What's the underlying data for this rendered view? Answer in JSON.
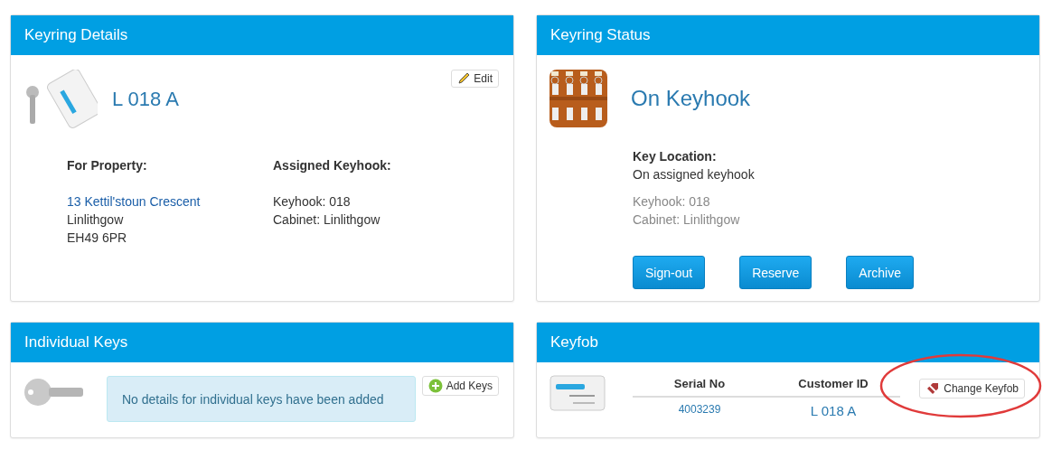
{
  "keyring_details": {
    "title": "Keyring Details",
    "tag": "L 018 A",
    "edit_button": "Edit",
    "property": {
      "label": "For Property:",
      "link": "13 Kettil'stoun Crescent",
      "lines": [
        "Linlithgow",
        "EH49 6PR"
      ]
    },
    "keyhook": {
      "label": "Assigned Keyhook:",
      "lines": [
        "Keyhook: 018",
        "Cabinet: Linlithgow"
      ]
    }
  },
  "keyring_status": {
    "title": "Keyring Status",
    "status": "On Keyhook",
    "location_label": "Key Location:",
    "location": "On assigned keyhook",
    "details": [
      "Keyhook: 018",
      "Cabinet: Linlithgow"
    ],
    "buttons": [
      "Sign-out",
      "Reserve",
      "Archive"
    ]
  },
  "individual_keys": {
    "title": "Individual Keys",
    "message": "No details for individual keys have been added",
    "add_button": "Add Keys"
  },
  "keyfob": {
    "title": "Keyfob",
    "columns": [
      "Serial No",
      "Customer ID"
    ],
    "rows": [
      [
        "4003239",
        "L 018 A"
      ]
    ],
    "change_button": "Change Keyfob"
  }
}
